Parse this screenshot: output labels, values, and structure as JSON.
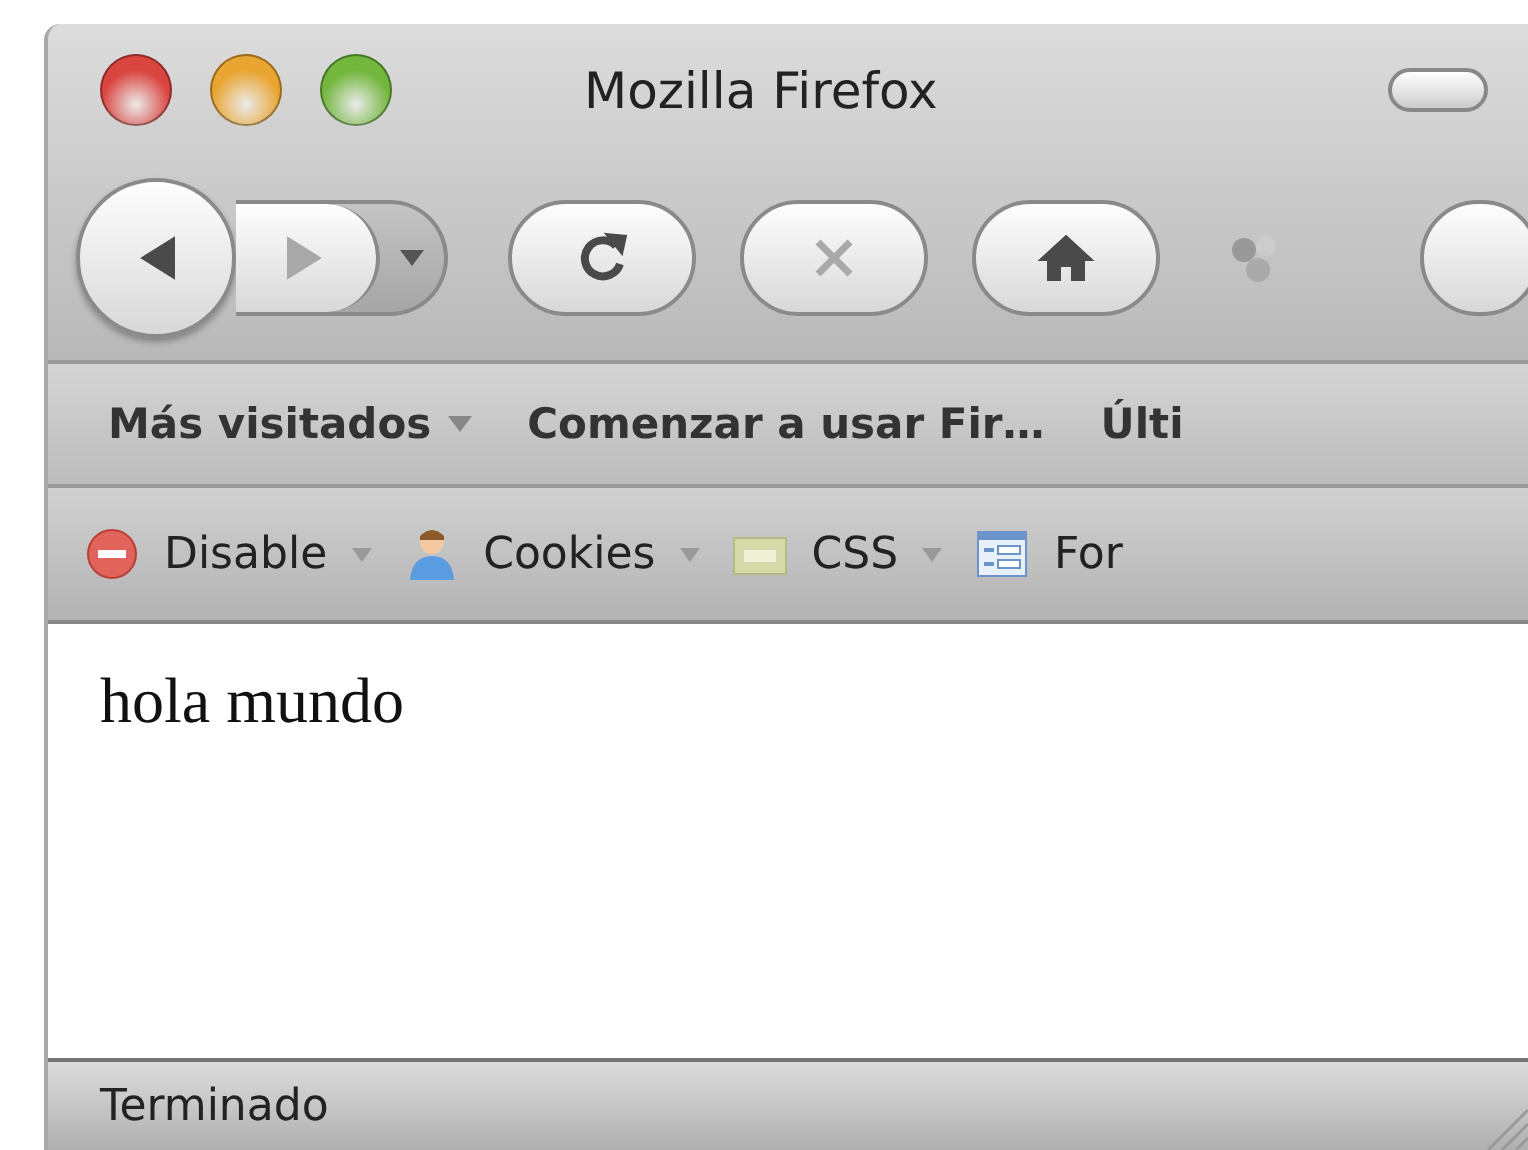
{
  "window": {
    "title": "Mozilla Firefox"
  },
  "window_buttons": [
    {
      "color": "#d9453f"
    },
    {
      "color": "#e9a532"
    },
    {
      "color": "#72b63c"
    }
  ],
  "navigation_buttons": [
    {
      "kind": "back",
      "disabled": false
    },
    {
      "kind": "forward",
      "disabled": true
    },
    {
      "kind": "reload",
      "disabled": false
    },
    {
      "kind": "stop",
      "disabled": true
    },
    {
      "kind": "home",
      "disabled": false
    }
  ],
  "bookmarks": [
    {
      "label": "Más visitados",
      "dropdown": true
    },
    {
      "label": "Comenzar a usar Fir…",
      "dropdown": false
    },
    {
      "label": "Últi",
      "dropdown": false
    }
  ],
  "developer_toolbar": [
    {
      "kind": "disable",
      "label": "Disable",
      "dropdown": true
    },
    {
      "kind": "cookies",
      "label": "Cookies",
      "dropdown": true
    },
    {
      "kind": "css",
      "label": "CSS",
      "dropdown": true
    },
    {
      "kind": "forms",
      "label": "For",
      "dropdown": false
    }
  ],
  "content": {
    "text": "hola mundo"
  },
  "status_bar": {
    "text": "Terminado"
  }
}
